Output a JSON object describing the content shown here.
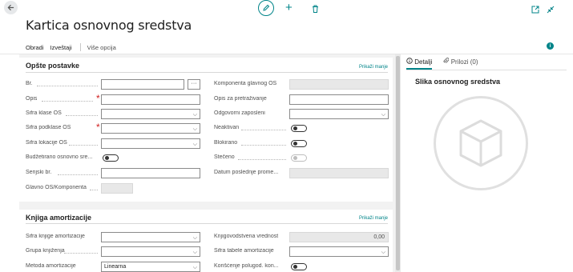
{
  "topbar": {
    "back_icon": "arrow-left-icon",
    "edit_icon": "pencil-icon",
    "add_icon": "plus-icon",
    "add_glyph": "+",
    "delete_icon": "trash-icon",
    "open_new_icon": "open-in-new-window-icon",
    "collapse_icon": "collapse-icon"
  },
  "page": {
    "title": "Kartica osnovnog sredstva"
  },
  "actions": {
    "items": [
      "Obradi",
      "Izveštaji"
    ],
    "more": "Više opcija"
  },
  "sections": {
    "general": {
      "title": "Opšte postavke",
      "toggle_label": "Prikaži manje",
      "left_fields": [
        {
          "label": "Br.",
          "value": ""
        },
        {
          "label": "Opis",
          "value": "",
          "required": true
        },
        {
          "label": "Šifra klase OS",
          "value": ""
        },
        {
          "label": "Šifra podklase OS",
          "value": "",
          "required": true
        },
        {
          "label": "Šifra lokacije OS",
          "value": ""
        },
        {
          "label": "Budžetirano osnovno sre...",
          "value": false
        },
        {
          "label": "Serijski br.",
          "value": ""
        },
        {
          "label": "Glavno OS/Komponenta",
          "value": ""
        }
      ],
      "right_fields": [
        {
          "label": "Komponenta glavnog OS",
          "value": ""
        },
        {
          "label": "Opis za pretraživanje",
          "value": ""
        },
        {
          "label": "Odgovorni zaposleni",
          "value": ""
        },
        {
          "label": "Neaktivan",
          "value": false
        },
        {
          "label": "Blokirano",
          "value": false
        },
        {
          "label": "Stečeno",
          "value": false
        },
        {
          "label": "Datum poslednje prome...",
          "value": ""
        }
      ]
    },
    "depreciation": {
      "title": "Knjiga amortizacije",
      "toggle_label": "Prikaži manje",
      "left_fields": [
        {
          "label": "Šifra knjige amortizacije",
          "value": ""
        },
        {
          "label": "Grupa knjiženja",
          "value": ""
        },
        {
          "label": "Metoda amortizacije",
          "value": "Linearna"
        }
      ],
      "right_fields": [
        {
          "label": "Knjigovodstvena vrednost",
          "value": "0,00"
        },
        {
          "label": "Šifra tabele amortizacije",
          "value": ""
        },
        {
          "label": "Korišćenje polugod. kon...",
          "value": false
        }
      ]
    }
  },
  "right_panel": {
    "tabs": [
      {
        "label": "Detalji",
        "icon": "info-circle-icon"
      },
      {
        "label": "Prilozi (0)",
        "icon": "paperclip-icon"
      }
    ],
    "factbox_title": "Slika osnovnog sredstva",
    "image_icon": "cube-icon"
  },
  "colors": {
    "accent": "#008489",
    "required": "#d01f1f",
    "background": "#f2f2f2"
  },
  "glyphs": {
    "chevron": "⌵",
    "ellipsis": "···",
    "info": "i",
    "asterisk": "*"
  }
}
